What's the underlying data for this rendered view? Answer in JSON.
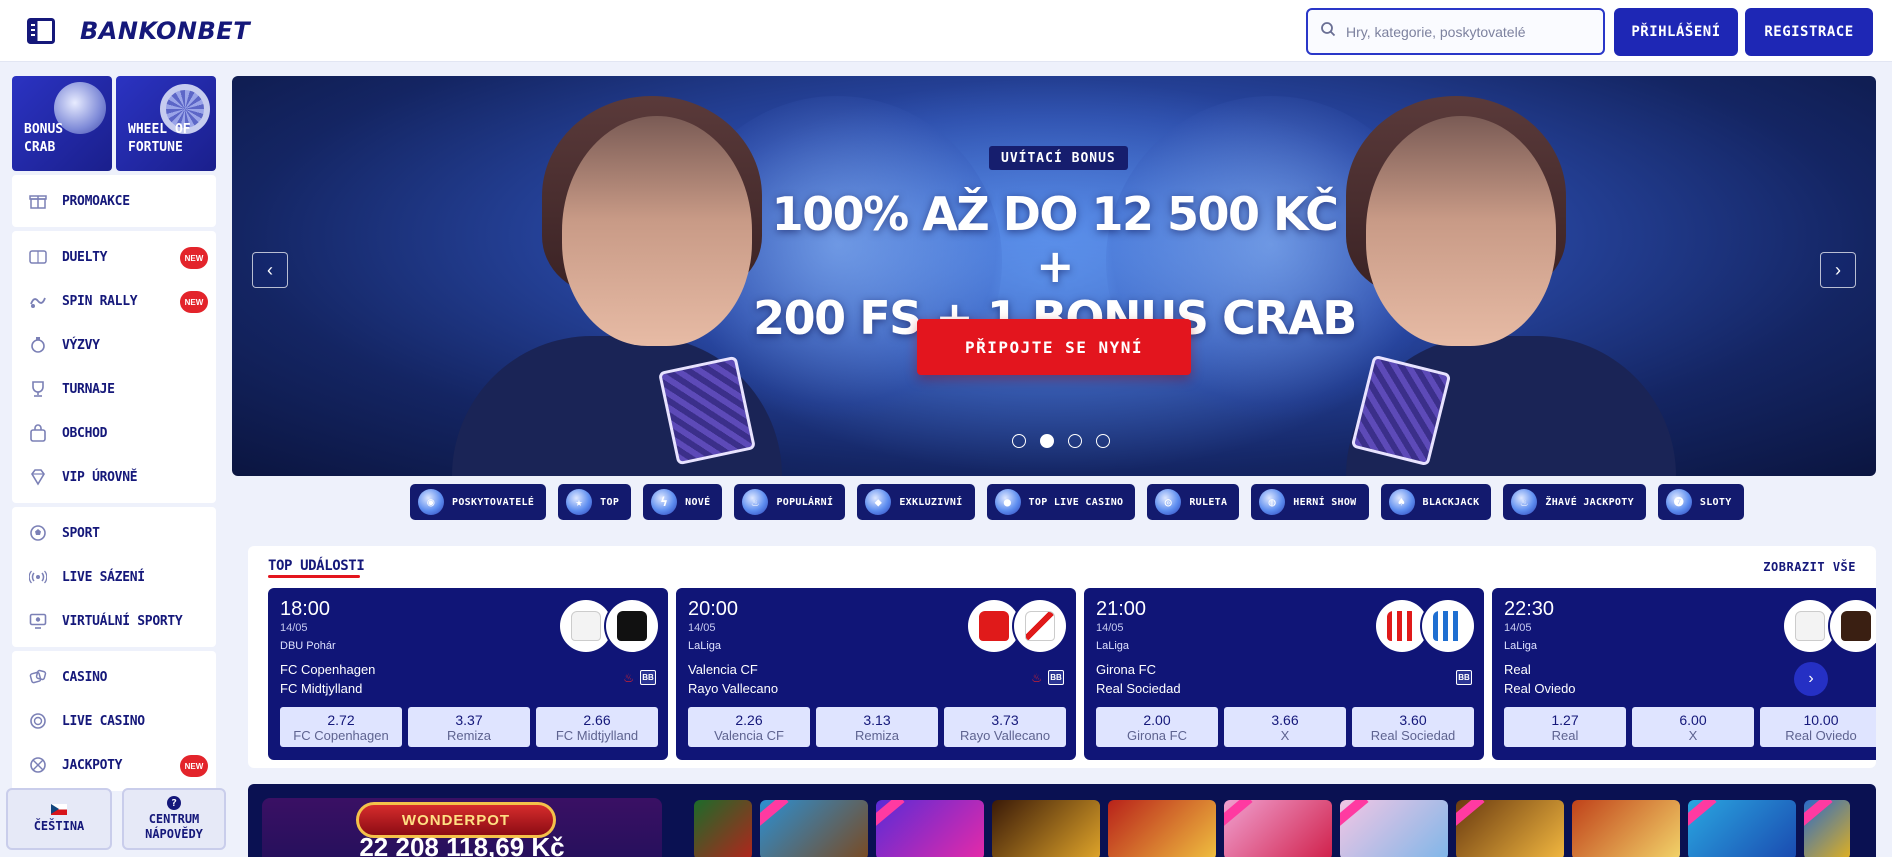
{
  "header": {
    "logo": "BANKONBET",
    "search_placeholder": "Hry, kategorie, poskytovatelé",
    "login_label": "PŘIHLÁŠENÍ",
    "register_label": "REGISTRACE"
  },
  "sidebar": {
    "tiles": [
      {
        "label": "BONUS CRAB"
      },
      {
        "label": "WHEEL OF FORTUNE"
      }
    ],
    "groups": [
      [
        {
          "label": "PROMOAKCE",
          "icon": "gift-icon"
        }
      ],
      [
        {
          "label": "DUELTY",
          "icon": "duel-icon",
          "badge": "NEW"
        },
        {
          "label": "SPIN RALLY",
          "icon": "rally-icon",
          "badge": "NEW"
        },
        {
          "label": "VÝZVY",
          "icon": "challenge-icon"
        },
        {
          "label": "TURNAJE",
          "icon": "trophy-icon"
        },
        {
          "label": "OBCHOD",
          "icon": "shop-icon"
        },
        {
          "label": "VIP ÚROVNĚ",
          "icon": "diamond-icon"
        }
      ],
      [
        {
          "label": "SPORT",
          "icon": "ball-icon"
        },
        {
          "label": "LIVE SÁZENÍ",
          "icon": "live-icon"
        },
        {
          "label": "VIRTUÁLNÍ SPORTY",
          "icon": "monitor-icon"
        }
      ],
      [
        {
          "label": "CASINO",
          "icon": "dice-icon"
        },
        {
          "label": "LIVE CASINO",
          "icon": "chip-icon"
        },
        {
          "label": "JACKPOTY",
          "icon": "jackpot-icon",
          "badge": "NEW"
        }
      ]
    ],
    "language_label": "ČEŠTINA",
    "help_label": "CENTRUM NÁPOVĚDY"
  },
  "banner": {
    "tag": "UVÍTACÍ BONUS",
    "headline_line1": "100% AŽ DO 12 500 KČ +",
    "headline_line2": "200 FS + 1 BONUS CRAB",
    "cta": "PŘIPOJTE SE NYNÍ",
    "slide_count": 4,
    "active_slide": 2
  },
  "categories": [
    "POSKYTOVATELÉ",
    "TOP",
    "NOVÉ",
    "POPULÁRNÍ",
    "EXKLUZIVNÍ",
    "TOP LIVE CASINO",
    "RULETA",
    "HERNÍ SHOW",
    "BLACKJACK",
    "ŽHAVÉ JACKPOTY",
    "SLOTY"
  ],
  "events": {
    "title": "TOP UDÁLOSTI",
    "show_all": "ZOBRAZIT VŠE",
    "items": [
      {
        "time": "18:00",
        "date": "14/05",
        "league": "DBU Pohár",
        "team1": "FC Copenhagen",
        "team2": "FC Midtjylland",
        "odds": [
          {
            "v": "2.72",
            "n": "FC Copenhagen"
          },
          {
            "v": "3.37",
            "n": "Remiza"
          },
          {
            "v": "2.66",
            "n": "FC Midtjylland"
          }
        ]
      },
      {
        "time": "20:00",
        "date": "14/05",
        "league": "LaLiga",
        "team1": "Valencia CF",
        "team2": "Rayo Vallecano",
        "odds": [
          {
            "v": "2.26",
            "n": "Valencia CF"
          },
          {
            "v": "3.13",
            "n": "Remiza"
          },
          {
            "v": "3.73",
            "n": "Rayo Vallecano"
          }
        ]
      },
      {
        "time": "21:00",
        "date": "14/05",
        "league": "LaLiga",
        "team1": "Girona FC",
        "team2": "Real Sociedad",
        "odds": [
          {
            "v": "2.00",
            "n": "Girona FC"
          },
          {
            "v": "3.66",
            "n": "X"
          },
          {
            "v": "3.60",
            "n": "Real Sociedad"
          }
        ]
      },
      {
        "time": "22:30",
        "date": "14/05",
        "league": "LaLiga",
        "team1": "Real",
        "team2": "Real Oviedo",
        "odds": [
          {
            "v": "1.27",
            "n": "Real"
          },
          {
            "v": "6.00",
            "n": "X"
          },
          {
            "v": "10.00",
            "n": "Real Oviedo"
          }
        ]
      }
    ]
  },
  "jackpot": {
    "badge": "WONDERPOT",
    "amount": "22 208 118,69 Kč"
  },
  "colors": {
    "brand_blue": "#1e27b5",
    "navy": "#101577",
    "red": "#e3151e"
  }
}
